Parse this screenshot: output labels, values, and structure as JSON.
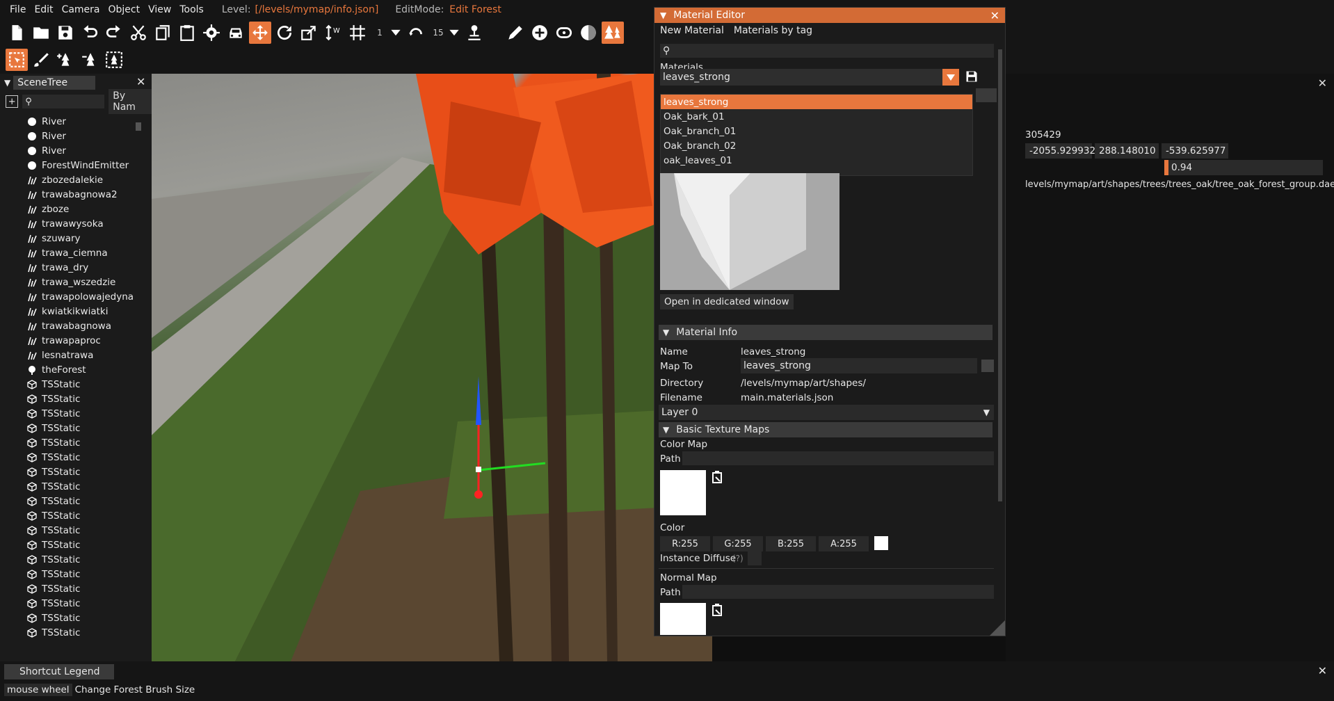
{
  "menubar": {
    "items": [
      "File",
      "Edit",
      "Camera",
      "Object",
      "View",
      "Tools"
    ],
    "level_label": "Level:",
    "level_value": "[/levels/mymap/info.json]",
    "editmode_label": "EditMode:",
    "editmode_value": "Edit Forest"
  },
  "toolbar": {
    "snap_value": "1",
    "angle_value": "15"
  },
  "scenetree": {
    "title": "SceneTree",
    "sort_label": "By Nam",
    "items": [
      {
        "label": "River",
        "icon": "circle-icon"
      },
      {
        "label": "River",
        "icon": "circle-icon"
      },
      {
        "label": "River",
        "icon": "circle-icon"
      },
      {
        "label": "ForestWindEmitter",
        "icon": "circle-icon"
      },
      {
        "label": "zbozedalekie",
        "icon": "grass-icon"
      },
      {
        "label": "trawabagnowa2",
        "icon": "grass-icon"
      },
      {
        "label": "zboze",
        "icon": "grass-icon"
      },
      {
        "label": "trawawysoka",
        "icon": "grass-icon"
      },
      {
        "label": "szuwary",
        "icon": "grass-icon"
      },
      {
        "label": "trawa_ciemna",
        "icon": "grass-icon"
      },
      {
        "label": "trawa_dry",
        "icon": "grass-icon"
      },
      {
        "label": "trawa_wszedzie",
        "icon": "grass-icon"
      },
      {
        "label": "trawapolowajedyna",
        "icon": "grass-icon"
      },
      {
        "label": "kwiatkikwiatki",
        "icon": "grass-icon"
      },
      {
        "label": "trawabagnowa",
        "icon": "grass-icon"
      },
      {
        "label": "trawapaproc",
        "icon": "grass-icon"
      },
      {
        "label": "lesnatrawa",
        "icon": "grass-icon"
      },
      {
        "label": "theForest",
        "icon": "forest-icon"
      },
      {
        "label": "TSStatic",
        "icon": "cube-icon"
      },
      {
        "label": "TSStatic",
        "icon": "cube-icon"
      },
      {
        "label": "TSStatic",
        "icon": "cube-icon"
      },
      {
        "label": "TSStatic",
        "icon": "cube-icon"
      },
      {
        "label": "TSStatic",
        "icon": "cube-icon"
      },
      {
        "label": "TSStatic",
        "icon": "cube-icon"
      },
      {
        "label": "TSStatic",
        "icon": "cube-icon"
      },
      {
        "label": "TSStatic",
        "icon": "cube-icon"
      },
      {
        "label": "TSStatic",
        "icon": "cube-icon"
      },
      {
        "label": "TSStatic",
        "icon": "cube-icon"
      },
      {
        "label": "TSStatic",
        "icon": "cube-icon"
      },
      {
        "label": "TSStatic",
        "icon": "cube-icon"
      },
      {
        "label": "TSStatic",
        "icon": "cube-icon"
      },
      {
        "label": "TSStatic",
        "icon": "cube-icon"
      },
      {
        "label": "TSStatic",
        "icon": "cube-icon"
      },
      {
        "label": "TSStatic",
        "icon": "cube-icon"
      },
      {
        "label": "TSStatic",
        "icon": "cube-icon"
      },
      {
        "label": "TSStatic",
        "icon": "cube-icon"
      }
    ]
  },
  "material_editor": {
    "title": "Material Editor",
    "menu": [
      "New Material",
      "Materials by tag"
    ],
    "materials_label": "Materials",
    "selected_material": "leaves_strong",
    "options": [
      "leaves_strong",
      "Oak_bark_01",
      "Oak_branch_01",
      "Oak_branch_02",
      "oak_leaves_01"
    ],
    "open_window_label": "Open in dedicated window",
    "info_header": "Material Info",
    "name_label": "Name",
    "name_value": "leaves_strong",
    "mapto_label": "Map To",
    "mapto_value": "leaves_strong",
    "directory_label": "Directory",
    "directory_value": "/levels/mymap/art/shapes/",
    "filename_label": "Filename",
    "filename_value": "main.materials.json",
    "layer_label": "Layer 0",
    "textures_header": "Basic Texture Maps",
    "colormap_label": "Color Map",
    "path_label": "Path",
    "color_label": "Color",
    "r_label": "R:255",
    "g_label": "G:255",
    "b_label": "B:255",
    "a_label": "A:255",
    "instance_diffuse_label": "Instance Diffuse",
    "help_marker": "(?)",
    "normalmap_label": "Normal Map",
    "normal_path_label": "Path"
  },
  "inspector": {
    "id_value": "305429",
    "pos_x": "-2055.929932",
    "pos_y": "288.148010",
    "pos_z": "-539.625977",
    "scale_value": "0.94",
    "scale_fraction": 0.94,
    "shape_path": "levels/mymap/art/shapes/trees/trees_oak/tree_oak_forest_group.dae"
  },
  "legend": {
    "title": "Shortcut Legend",
    "key": "mouse wheel",
    "action": "Change Forest Brush Size"
  },
  "colors": {
    "accent": "#e8773d",
    "title_bar": "#d36b35",
    "panel_bg": "#1b1b1b"
  }
}
